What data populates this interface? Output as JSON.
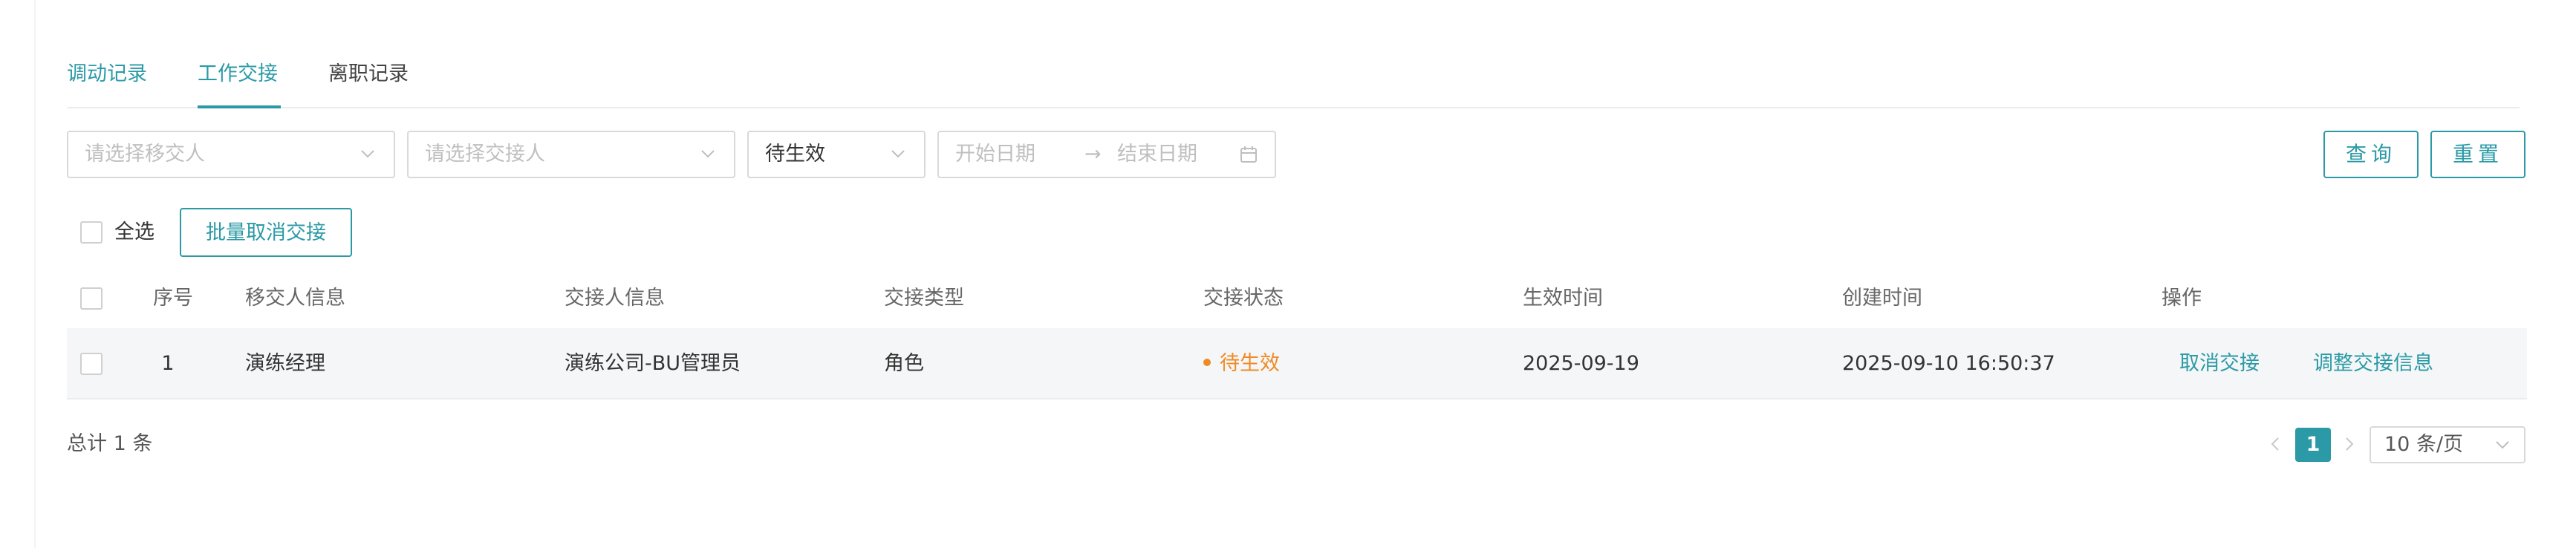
{
  "tabs": [
    {
      "label": "调动记录"
    },
    {
      "label": "工作交接"
    },
    {
      "label": "离职记录"
    }
  ],
  "active_tab": "工作交接",
  "filters": {
    "transferor_placeholder": "请选择移交人",
    "receiver_placeholder": "请选择交接人",
    "status_value": "待生效",
    "start_date_placeholder": "开始日期",
    "range_arrow": "→",
    "end_date_placeholder": "结束日期"
  },
  "buttons": {
    "query": "查询",
    "reset": "重置",
    "batch_cancel": "批量取消交接"
  },
  "select_all_label": "全选",
  "table": {
    "columns": [
      "序号",
      "移交人信息",
      "交接人信息",
      "交接类型",
      "交接状态",
      "生效时间",
      "创建时间",
      "操作"
    ],
    "rows": [
      {
        "seq": "1",
        "transferor": "演练经理",
        "receiver": "演练公司-BU管理员",
        "type": "角色",
        "status": "待生效",
        "effective_time": "2025-09-19",
        "created_time": "2025-09-10 16:50:37",
        "actions": [
          "取消交接",
          "调整交接信息"
        ]
      }
    ]
  },
  "footer": {
    "total": "总计 1 条",
    "current_page": "1",
    "page_size": "10 条/页"
  },
  "colors": {
    "accent": "#2b9aa6",
    "status_pending": "#f08a24",
    "border": "#d9d9d9",
    "row_bg": "#f5f6f7"
  },
  "icons": [
    "chevron-down-icon",
    "calendar-icon",
    "chevron-left-icon",
    "chevron-right-icon"
  ]
}
